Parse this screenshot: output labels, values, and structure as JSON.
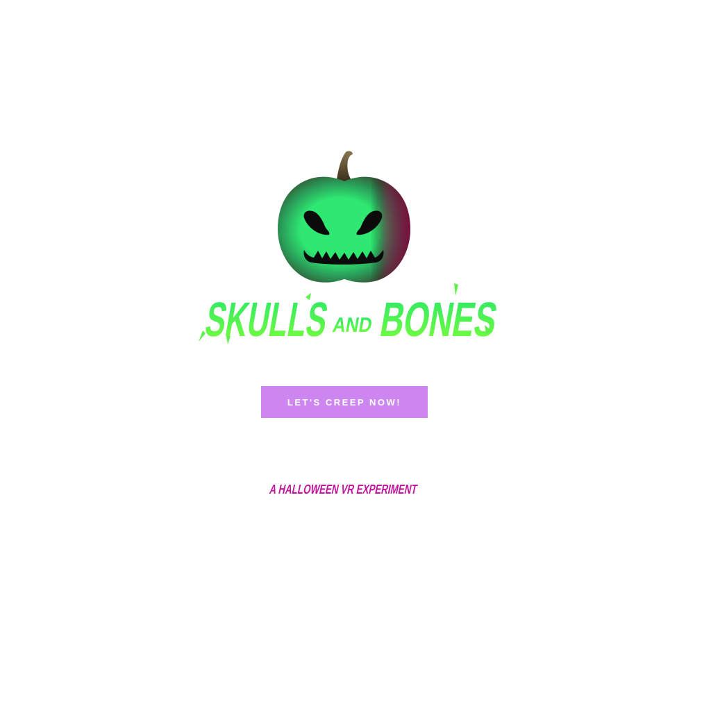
{
  "brand": {
    "name": "SKULLS AND BONES",
    "words": [
      "SKULLS",
      "AND",
      "BONES"
    ],
    "tagline": "A HALLOWEEN VR EXPERIMENT"
  },
  "cta": {
    "label": "LET'S CREEP NOW!"
  },
  "colors": {
    "title_green_light": "#7dff3a",
    "title_green": "#25e66a",
    "button_bg": "#cd85ef",
    "tagline_magenta": "#c0179e",
    "pumpkin_glow": "#2ee872",
    "pumpkin_dark": "#3b3524",
    "pumpkin_crimson": "#7c0b3e",
    "stem": "#5a4a2e"
  },
  "icons": {
    "logo": "jack-o-lantern-icon"
  }
}
